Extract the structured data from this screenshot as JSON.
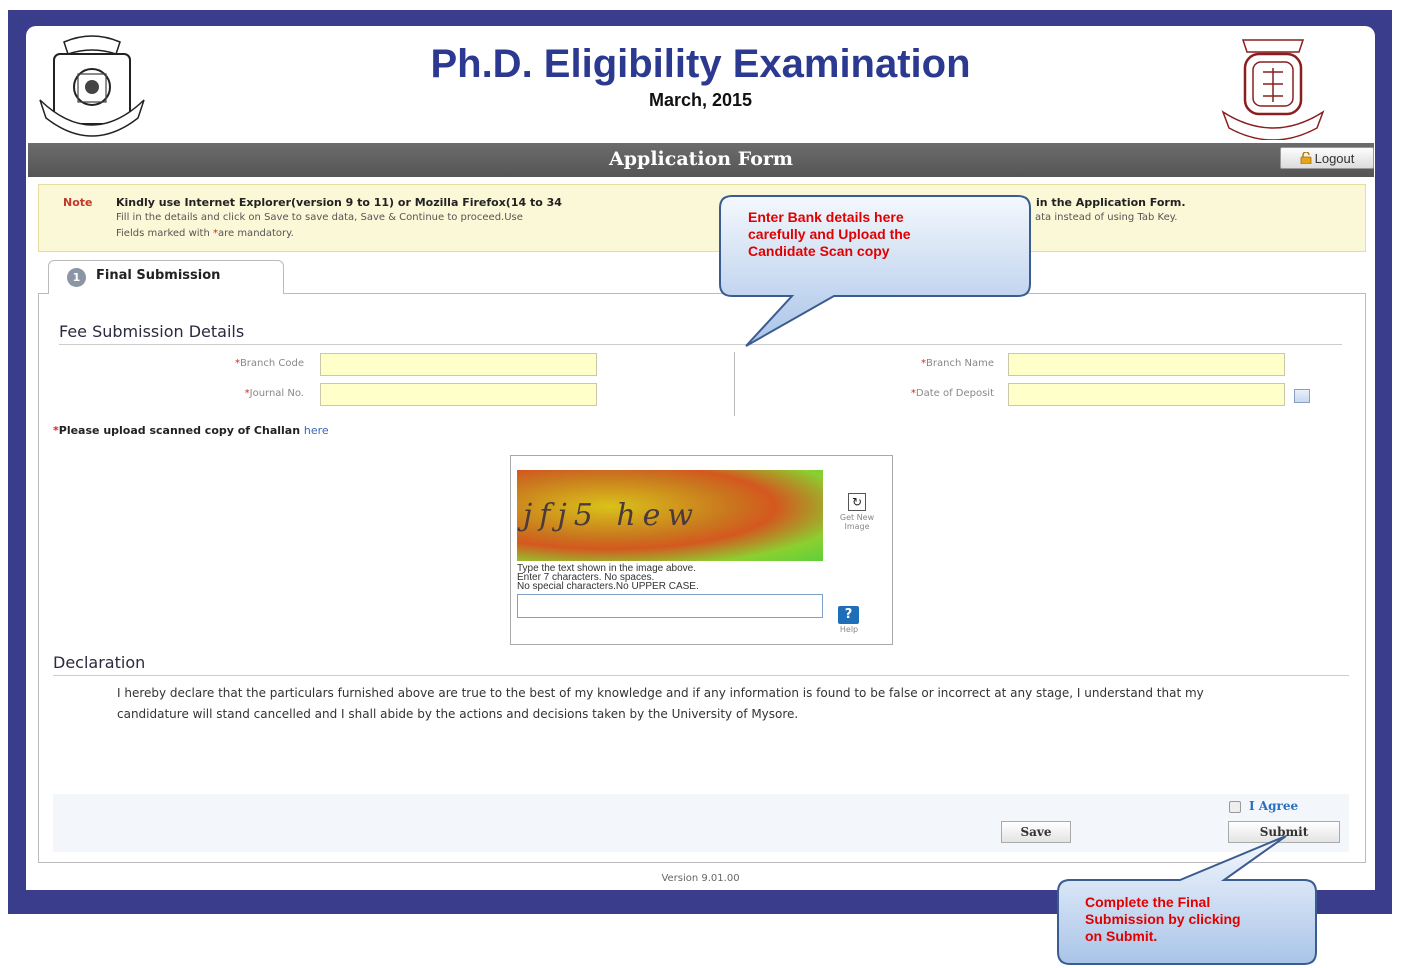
{
  "header": {
    "title": "Ph.D. Eligibility Examination",
    "subtitle": "March, 2015"
  },
  "bar": {
    "title": "Application Form",
    "logout_label": "Logout"
  },
  "note": {
    "label": "Note",
    "line1a": "Kindly use Internet Explorer(version 9 to 11) or Mozilla Firefox(14 to 34",
    "line1b": "in the Application Form.",
    "line2a": "Fill in the details and click on Save to save data, Save & Continue to proceed.Use",
    "line2b": "ata instead of using Tab Key.",
    "line3_pre": "Fields marked with ",
    "line3_star": "*",
    "line3_post": "are mandatory."
  },
  "tab": {
    "number": "1",
    "label": "Final Submission"
  },
  "fee": {
    "title": "Fee Submission Details",
    "star": "*",
    "branch_code_label": "Branch Code",
    "journal_no_label": "Journal No.",
    "branch_name_label": "Branch Name",
    "date_of_deposit_label": "Date of Deposit",
    "upload_text": "Please upload scanned copy of Challan ",
    "upload_link": "here"
  },
  "captcha": {
    "image_text": "jfj5 hew",
    "refresh_label": "Get New Image",
    "instruction1": "Type the text shown in the image above.",
    "instruction2": "Enter 7 characters. No spaces.",
    "instruction3": "No special characters.No UPPER CASE.",
    "help_label": "Help"
  },
  "declaration": {
    "title": "Declaration",
    "text": "I hereby declare that the particulars furnished above are true to the best of my knowledge and if any information is found to be false or incorrect at any stage, I understand that my candidature will stand cancelled and I shall abide by the actions and decisions taken by the University of Mysore."
  },
  "actions": {
    "agree_label": "I Agree",
    "save_label": "Save",
    "submit_label": "Submit"
  },
  "version": "Version 9.01.00",
  "callouts": {
    "bank": [
      "Enter Bank details here",
      "carefully and Upload the",
      "Candidate Scan copy"
    ],
    "submit": [
      "Complete the Final",
      "Submission by clicking",
      "on Submit."
    ]
  }
}
